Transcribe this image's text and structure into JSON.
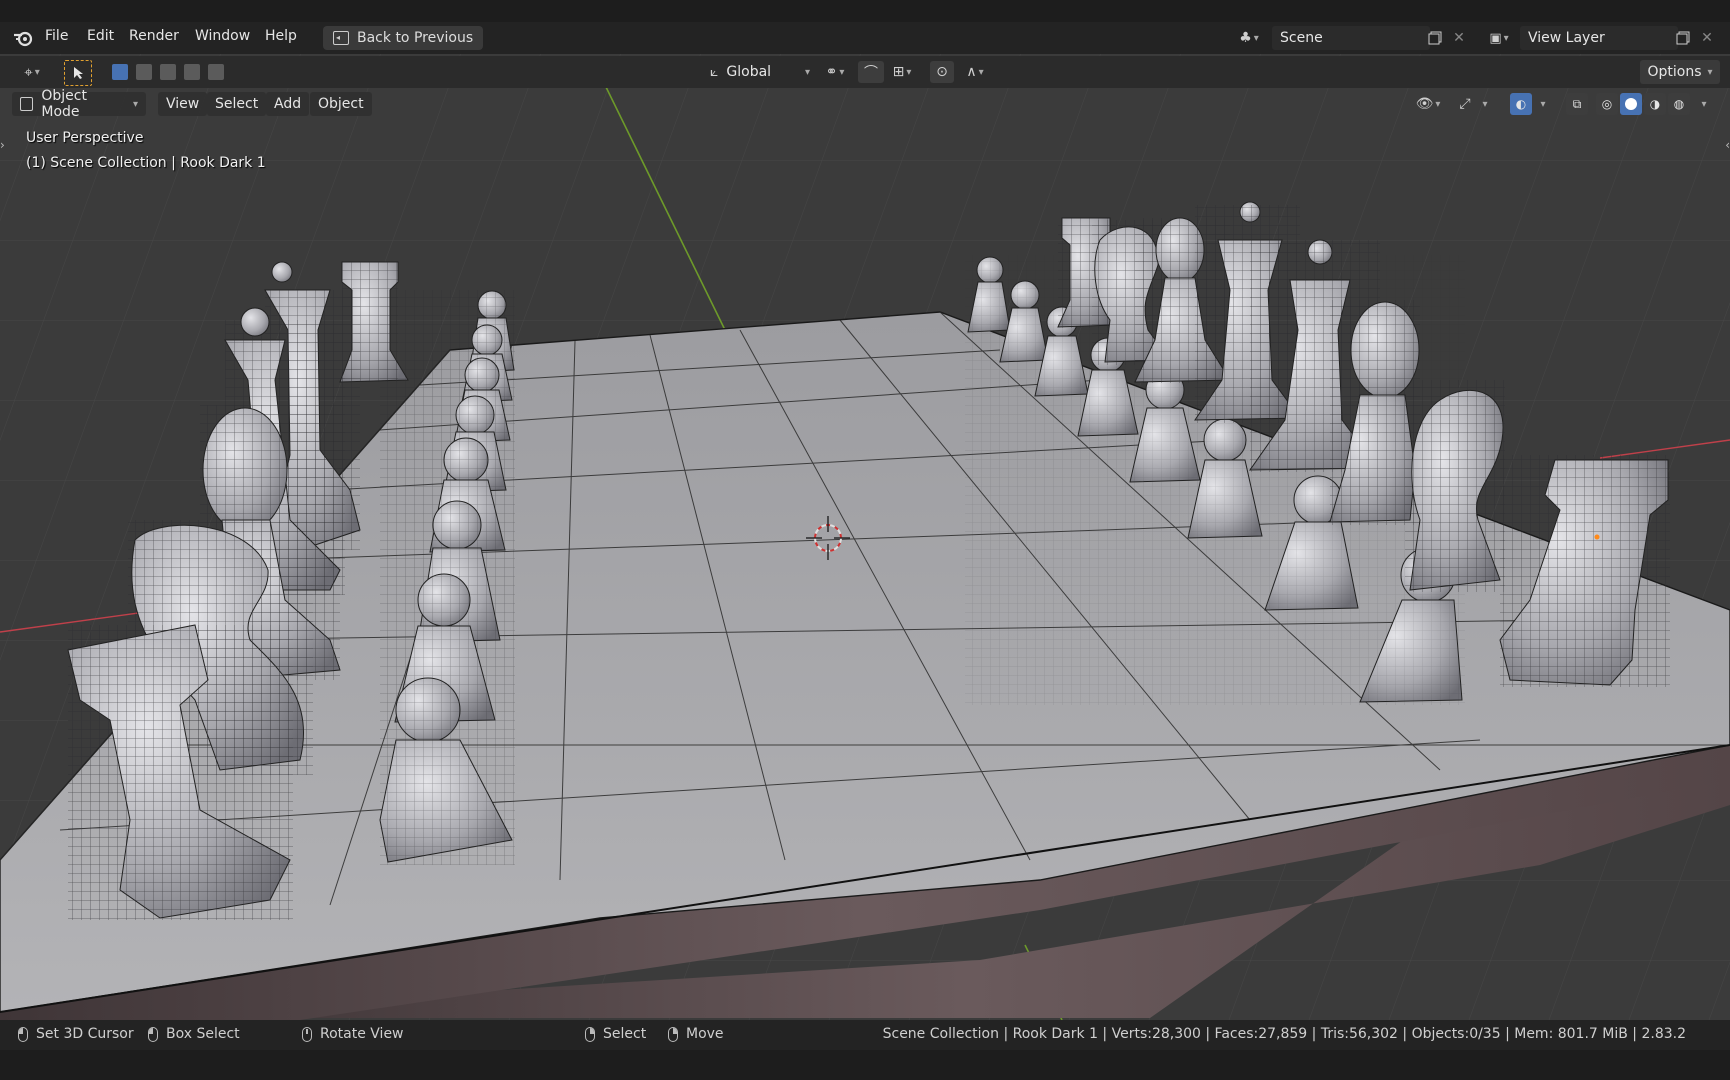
{
  "menubar": {
    "items": [
      "File",
      "Edit",
      "Render",
      "Window",
      "Help"
    ],
    "back_button": "Back to Previous",
    "scene_name": "Scene",
    "view_layer_name": "View Layer"
  },
  "tool_header": {
    "transform_orientation": "Global",
    "options_label": "Options"
  },
  "viewport_header": {
    "mode_label": "Object Mode",
    "menus": [
      "View",
      "Select",
      "Add",
      "Object"
    ]
  },
  "viewport": {
    "perspective_label": "User Perspective",
    "collection_label": "(1) Scene Collection | Rook Dark 1",
    "colors": {
      "background": "#3d3d3d",
      "board_top": "#a9a9ad",
      "board_side": "#5b4e50",
      "x_axis": "#c0404a",
      "y_axis": "#6d9a2a",
      "accent": "#4772b3"
    }
  },
  "statusbar": {
    "set_cursor": "Set 3D Cursor",
    "box_select": "Box Select",
    "rotate_view": "Rotate View",
    "select": "Select",
    "move": "Move",
    "stats": "Scene Collection | Rook Dark 1 | Verts:28,300 | Faces:27,859 | Tris:56,302 | Objects:0/35 | Mem: 801.7 MiB | 2.83.2"
  },
  "icons": [
    "blender-logo-icon",
    "back-icon",
    "editor-type-icon",
    "select-tool-icon",
    "transform-orientation-icon",
    "pivot-icon",
    "snap-icon",
    "proportional-icon",
    "visibility-icon",
    "gizmo-icon",
    "overlay-icon",
    "xray-icon",
    "wireframe-shading-icon",
    "solid-shading-icon",
    "material-shading-icon",
    "rendered-shading-icon"
  ]
}
